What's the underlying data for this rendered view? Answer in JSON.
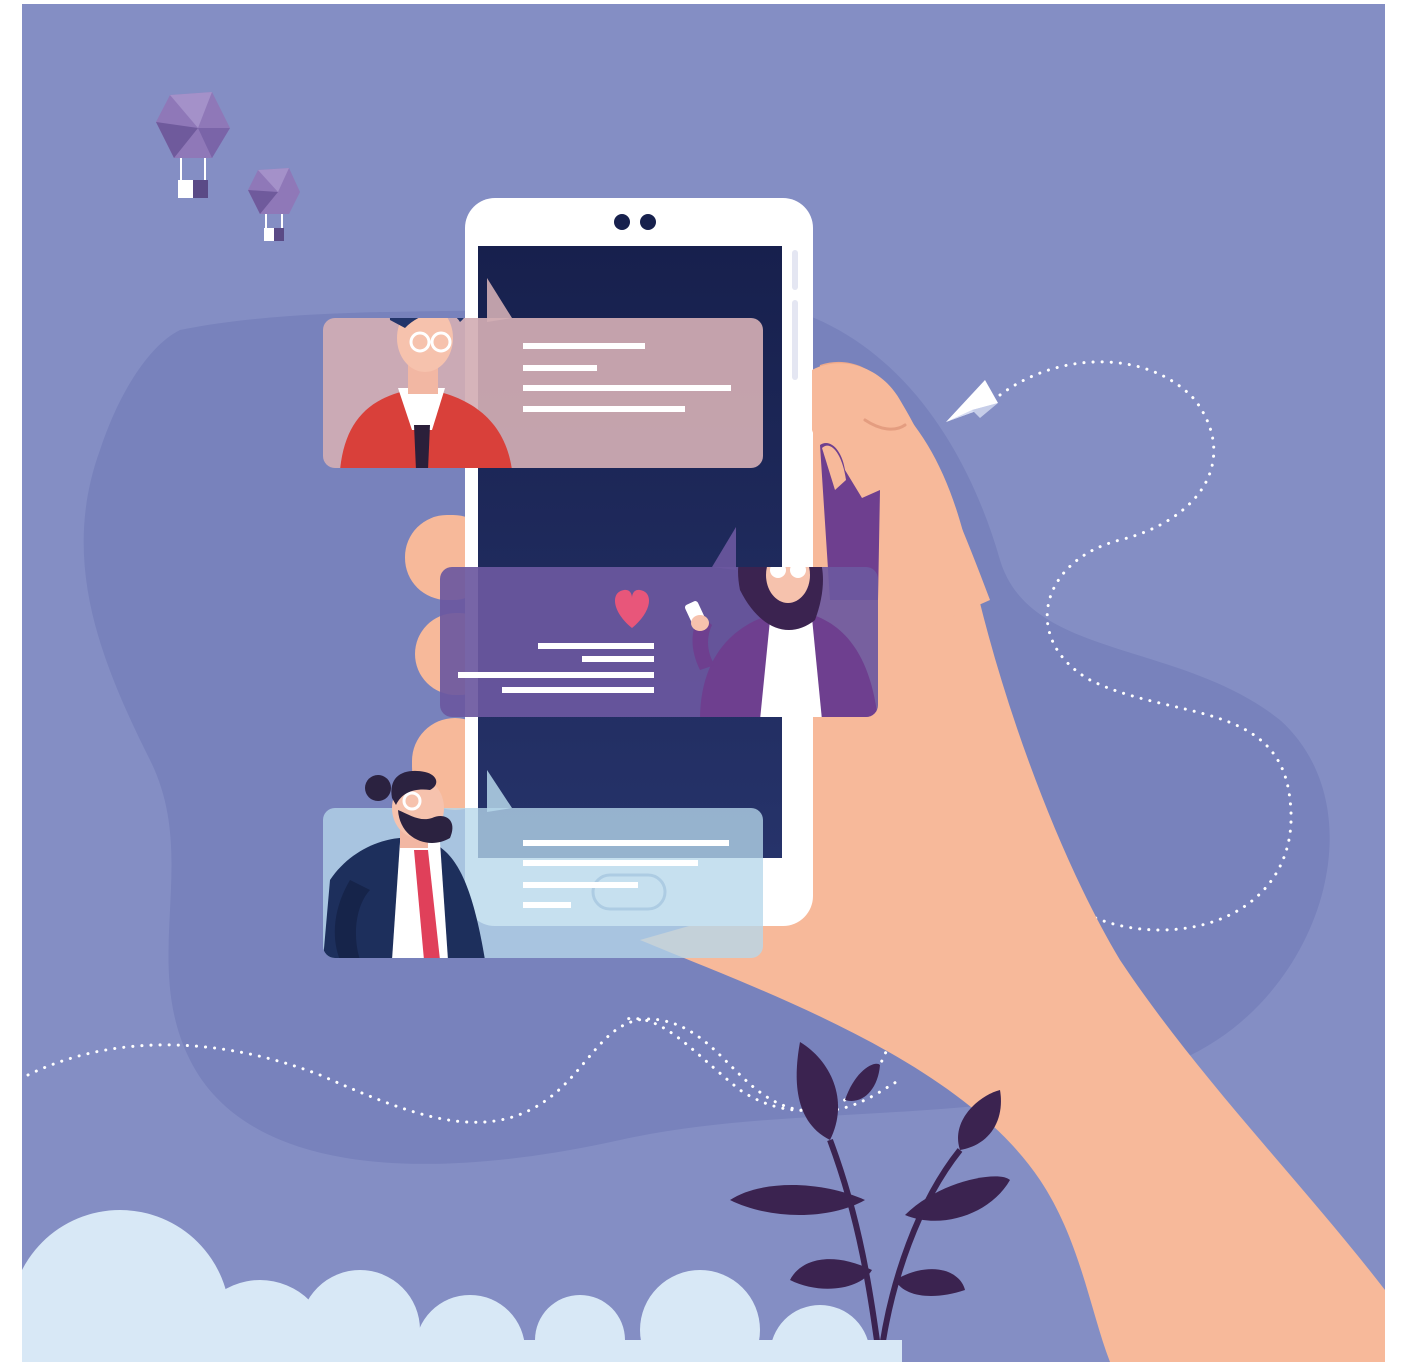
{
  "scene": {
    "description_visible_text": [],
    "palette": {
      "background": "#848ec4",
      "background_blob": "#7882bc",
      "frame": "#ffffff",
      "skin": "#f7b99a",
      "skin_shadow": "#eea98a",
      "phone_body": "#ffffff",
      "screen_top": "#17204d",
      "screen_bottom": "#26336a",
      "bubble_top": "#d2aeb4",
      "bubble_middle": "#6b58a0",
      "bubble_bottom": "#b6d7ea",
      "heart": "#e8567a",
      "plant": "#3b2350",
      "cloud": "#d8e8f6",
      "man_shirt": "#d9403a",
      "woman_jacket": "#6e3f8f",
      "suit": "#1d2f5c",
      "tie": "#e0405a",
      "hair": "#23356a",
      "balloon": "#8f78b8"
    },
    "icons": [
      "heart-icon",
      "paper-plane-icon",
      "hot-air-balloon-icon",
      "leaf-icon",
      "cloud-icon"
    ]
  }
}
